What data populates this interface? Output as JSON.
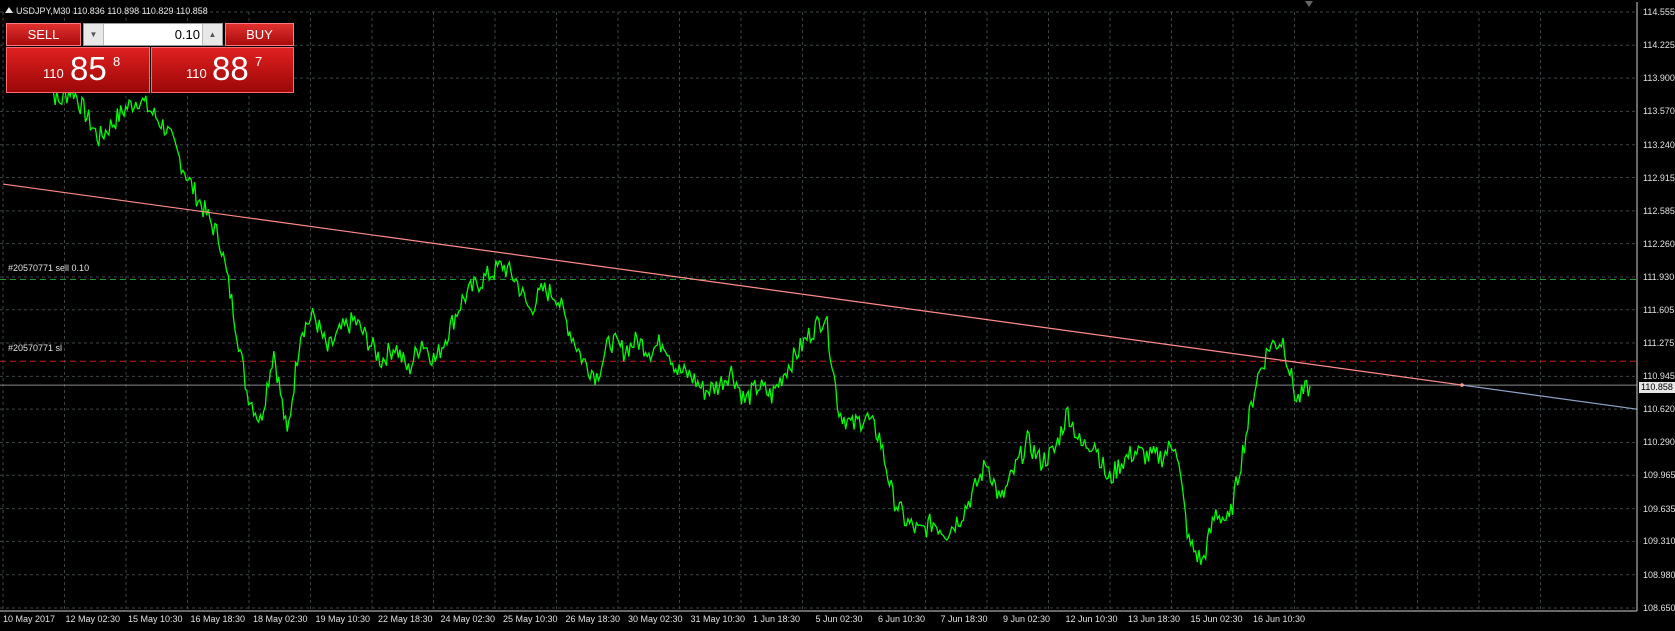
{
  "window": {
    "symbol_header": "USDJPY,M30  110.836 110.898 110.829 110.858"
  },
  "trade_panel": {
    "sell_label": "SELL",
    "buy_label": "BUY",
    "lot_value": "0.10",
    "sell_price": {
      "prefix": "110",
      "big": "85",
      "sup": "8"
    },
    "buy_price": {
      "prefix": "110",
      "big": "88",
      "sup": "7"
    }
  },
  "orders": {
    "sell_order_label": "#20570771 sell 0.10",
    "sl_label": "#20570771 sl"
  },
  "bid_tag": "110.858",
  "colors": {
    "price_line": "#00ff00",
    "grid": "#3c4446",
    "trendline": "#ff8a8a",
    "order_line": "#1f9a2a",
    "sl_line": "#c81e1e",
    "bid_line": "#8a8a8a"
  },
  "chart_data": {
    "type": "line",
    "symbol": "USDJPY",
    "timeframe": "M30",
    "x_tick_labels": [
      "10 May 2017",
      "12 May 02:30",
      "15 May 10:30",
      "16 May 18:30",
      "18 May 02:30",
      "19 May 10:30",
      "22 May 18:30",
      "24 May 02:30",
      "25 May 10:30",
      "26 May 18:30",
      "30 May 02:30",
      "31 May 10:30",
      "1 Jun 18:30",
      "5 Jun 02:30",
      "6 Jun 10:30",
      "7 Jun 18:30",
      "9 Jun 02:30",
      "12 Jun 10:30",
      "13 Jun 18:30",
      "15 Jun 02:30",
      "16 Jun 10:30"
    ],
    "y_tick_labels": [
      "114.555",
      "114.225",
      "113.900",
      "113.570",
      "113.240",
      "112.915",
      "112.585",
      "112.260",
      "111.930",
      "111.605",
      "111.275",
      "110.945",
      "110.620",
      "110.290",
      "109.965",
      "109.635",
      "109.310",
      "108.980",
      "108.650"
    ],
    "ylim": [
      108.65,
      114.555
    ],
    "series": [
      {
        "values": [
          113.95,
          113.65,
          113.8,
          113.55,
          113.3,
          113.45,
          113.6,
          113.7,
          113.55,
          113.4,
          113.1,
          112.8,
          112.55,
          112.3,
          111.6,
          110.8,
          110.5,
          111.2,
          110.35,
          111.4,
          111.55,
          111.2,
          111.4,
          111.5,
          111.3,
          111.1,
          111.25,
          111.0,
          111.3,
          111.1,
          111.4,
          111.7,
          111.85,
          111.95,
          112.05,
          111.9,
          111.6,
          111.8,
          111.75,
          111.4,
          111.1,
          110.95,
          111.3,
          111.2,
          111.3,
          111.2,
          111.3,
          111.0,
          110.95,
          110.8,
          110.85,
          111.0,
          110.7,
          110.85,
          110.75,
          111.0,
          111.2,
          111.4,
          111.55,
          110.6,
          110.45,
          110.55,
          110.35,
          109.75,
          109.5,
          109.4,
          109.5,
          109.4,
          109.55,
          109.8,
          110.1,
          109.7,
          110.0,
          110.3,
          110.1,
          110.2,
          110.6,
          110.25,
          110.3,
          109.9,
          110.1,
          110.2,
          110.15,
          110.15,
          110.3,
          109.3,
          109.1,
          109.6,
          109.5,
          110.2,
          110.9,
          111.25,
          111.3,
          110.7,
          110.85
        ]
      }
    ],
    "trendline": {
      "start_value": 112.85,
      "end_value": 110.62
    },
    "order_levels": {
      "sell": 111.905,
      "stop_loss": 111.095,
      "bid": 110.858
    },
    "grid": true
  }
}
